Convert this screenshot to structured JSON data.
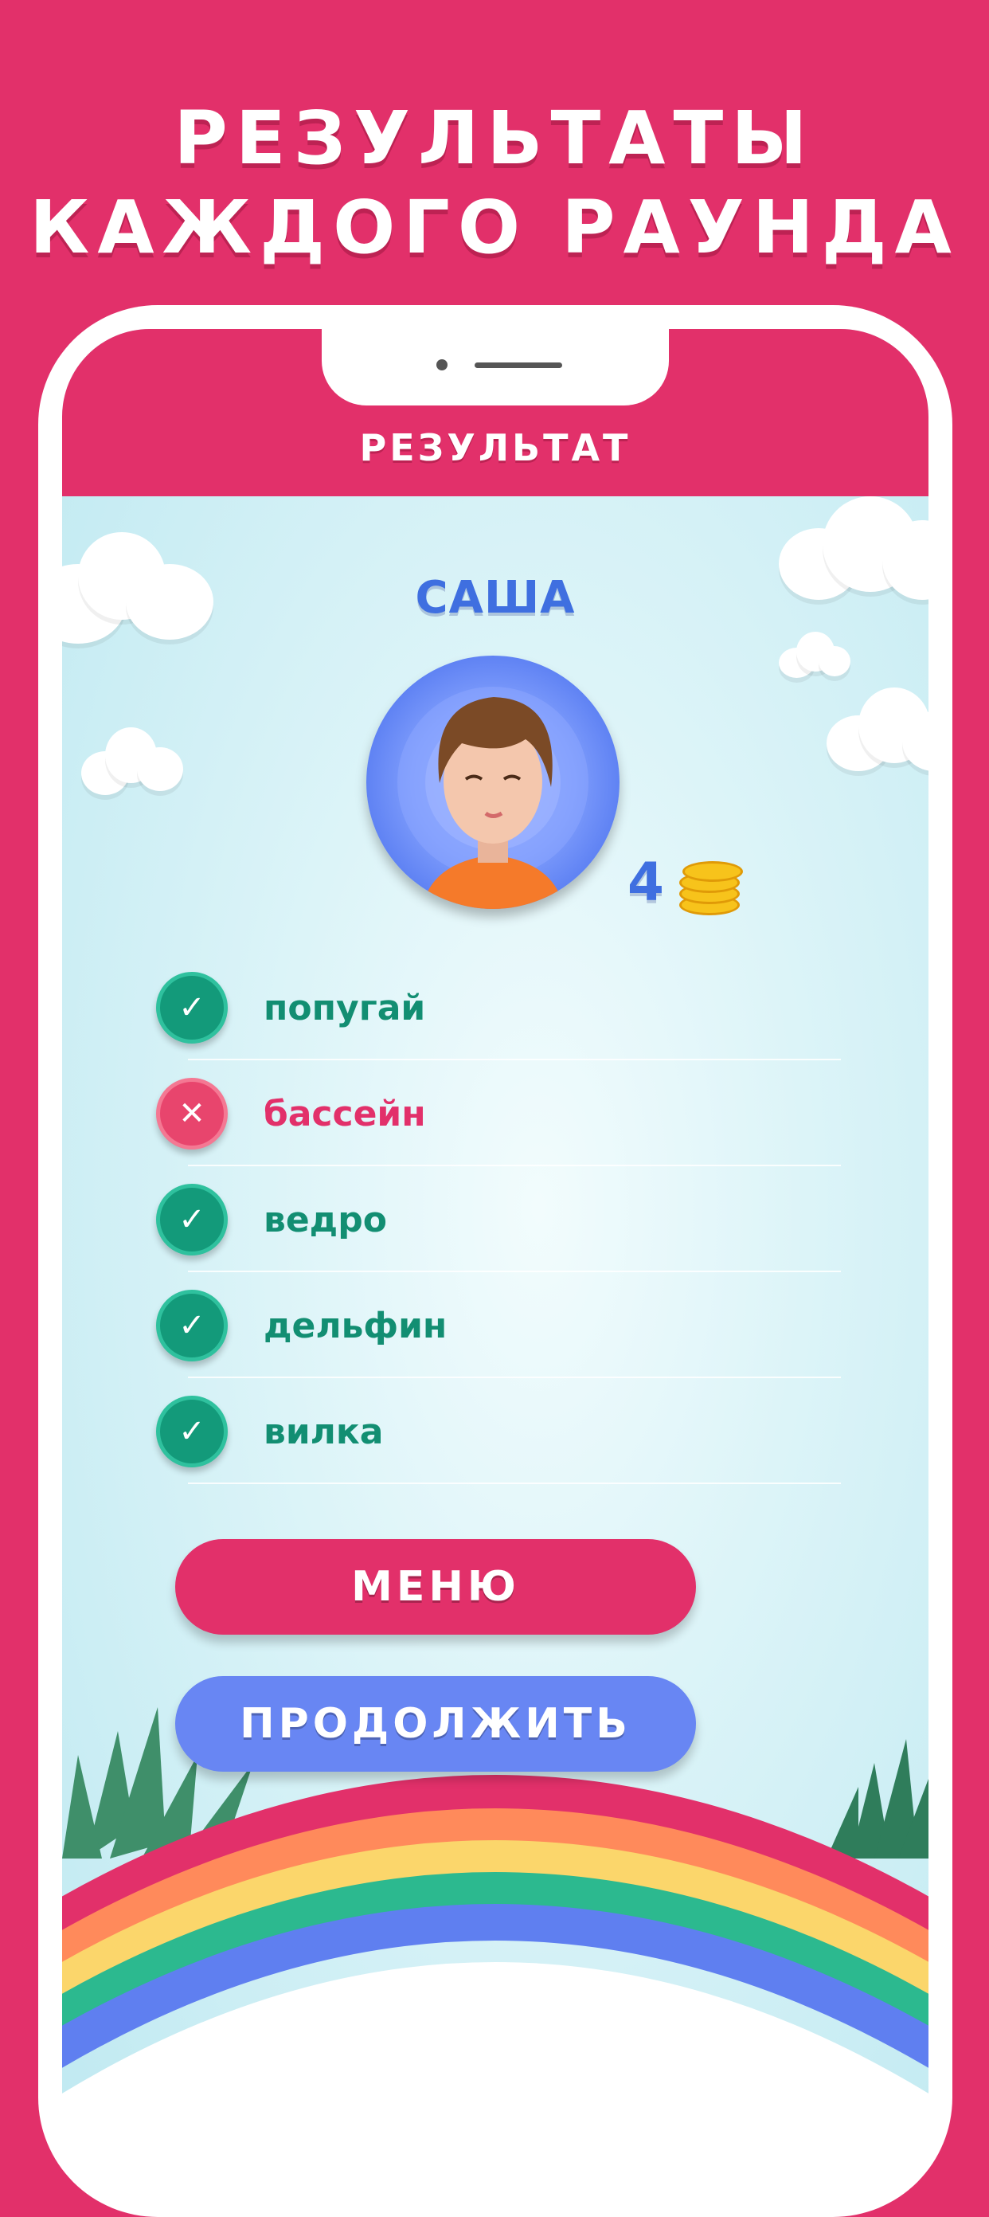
{
  "promo": {
    "line1": "РЕЗУЛЬТАТЫ",
    "line2": "КАЖДОГО РАУНДА"
  },
  "header": {
    "title": "РЕЗУЛЬТАТ"
  },
  "player": {
    "name": "САША",
    "coins": "4"
  },
  "results": [
    {
      "word": "попугай",
      "correct": true
    },
    {
      "word": "бассейн",
      "correct": false
    },
    {
      "word": "ведро",
      "correct": true
    },
    {
      "word": "дельфин",
      "correct": true
    },
    {
      "word": "вилка",
      "correct": true
    }
  ],
  "buttons": {
    "menu": "МЕНЮ",
    "continue": "ПРОДОЛЖИТЬ"
  },
  "colors": {
    "background": "#e2306a",
    "accent_blue": "#3f6fe0",
    "correct": "#139a7a",
    "wrong": "#e8456d",
    "continue_button": "#6886f3"
  },
  "icons": {
    "correct": "check-icon",
    "wrong": "cross-icon",
    "coins": "coin-stack-icon"
  }
}
